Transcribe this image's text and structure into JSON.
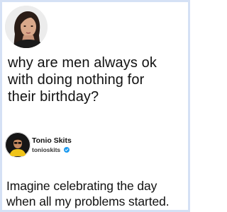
{
  "post": {
    "text_lines": [
      "why are men always ok",
      "with doing nothing for",
      "their birthday?"
    ]
  },
  "quote": {
    "author_name": "Tonio Skits",
    "author_handle": "tonioskits"
  },
  "reply": {
    "text_lines": [
      "Imagine celebrating the day",
      "when all my problems started."
    ]
  },
  "colors": {
    "frame_border": "#d5e1f5",
    "verified_badge": "#1d9bf0",
    "text": "#111111"
  },
  "icons": {
    "top_avatar": "profile-photo-woman",
    "quote_avatar": "profile-photo-man",
    "verified": "verified-badge-icon"
  }
}
